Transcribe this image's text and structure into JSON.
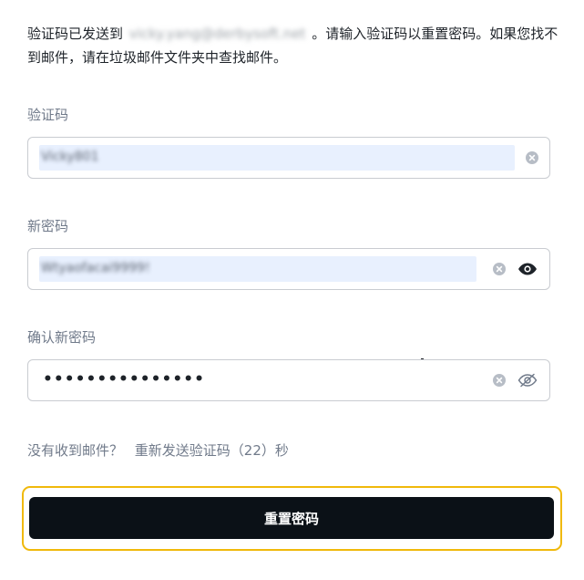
{
  "intro": {
    "prefix": "验证码已发送到",
    "email": "vicky.yang@derbysoft.net",
    "suffix": "。请输入验证码以重置密码。如果您找不到邮件，请在垃圾邮件文件夹中查找邮件。"
  },
  "code_field": {
    "label": "验证码",
    "value": "Vicky801"
  },
  "new_password": {
    "label": "新密码",
    "value": "Wtyaofacai9999!"
  },
  "confirm_password": {
    "label": "确认新密码",
    "value": "•••••••••••••••"
  },
  "resend": {
    "question": "没有收到邮件？",
    "link": "重新发送验证码（22）秒"
  },
  "submit": {
    "label": "重置密码"
  },
  "colors": {
    "accent_border": "#f0b90b",
    "button_bg": "#0b1117",
    "autofill_bg": "#e8f0fe"
  },
  "icons": {
    "clear": "clear-circle-icon",
    "show": "eye-icon",
    "hide": "eye-slash-icon"
  }
}
